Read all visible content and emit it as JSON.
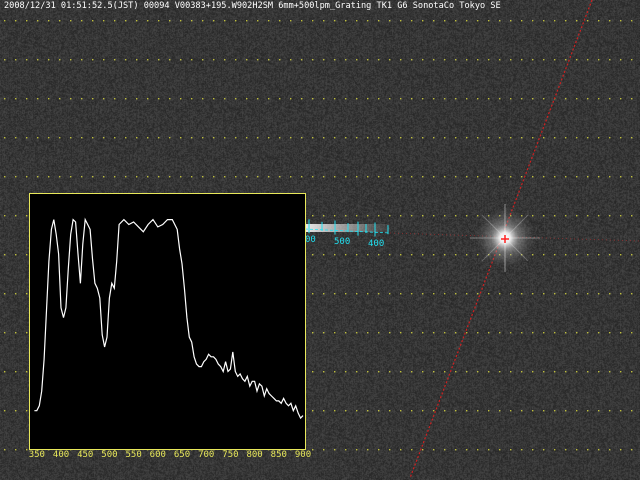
{
  "header": {
    "caption": "2008/12/31 01:51:52.5(JST) 00094 V00383+195.W902H2SM 6mm+500lpm_Grating TK1 G6 SonotaCo Tokyo SE"
  },
  "calibration_scale": {
    "labels": [
      "00",
      "500",
      "400"
    ]
  },
  "colors": {
    "panel_border": "#e8e85a",
    "spectrum_line": "#ffffff",
    "grid_dots": "#d8d840",
    "scale_marks": "#22e0f0",
    "meteor_track": "#d02020",
    "marker": "#ff2020"
  },
  "icons": {
    "zero_order_marker": "red-cross-marker"
  },
  "chart_data": {
    "type": "line",
    "title": "",
    "xlabel": "",
    "ylabel": "",
    "xlim": [
      340,
      900
    ],
    "ylim": [
      0,
      100
    ],
    "tick_labels": [
      "350",
      "400",
      "450",
      "500",
      "550",
      "600",
      "650",
      "700",
      "750",
      "800",
      "850",
      "900"
    ],
    "series": [
      {
        "x": [
          345,
          350,
          355,
          360,
          365,
          370,
          375,
          380,
          385,
          390,
          395,
          400,
          405,
          410,
          415,
          420,
          425,
          430,
          435,
          440,
          445,
          450,
          455,
          460,
          465,
          470,
          475,
          480,
          485,
          490,
          495,
          500,
          505,
          510,
          515,
          520,
          530,
          540,
          550,
          560,
          570,
          580,
          590,
          600,
          610,
          620,
          630,
          640,
          645,
          650,
          655,
          660,
          665,
          670,
          675,
          680,
          685,
          690,
          695,
          700,
          705,
          710,
          715,
          720,
          725,
          730,
          735,
          740,
          745,
          750,
          755,
          760,
          765,
          770,
          775,
          780,
          785,
          790,
          795,
          800,
          805,
          810,
          815,
          820,
          825,
          830,
          835,
          840,
          845,
          850,
          855,
          860,
          865,
          870,
          875,
          880,
          885,
          890,
          895,
          900
        ],
        "y": [
          14,
          14,
          16,
          22,
          35,
          55,
          75,
          88,
          92,
          86,
          78,
          56,
          52,
          56,
          72,
          86,
          92,
          91,
          78,
          66,
          82,
          92,
          90,
          88,
          76,
          66,
          64,
          60,
          45,
          40,
          44,
          60,
          66,
          64,
          75,
          90,
          92,
          90,
          91,
          89,
          87,
          90,
          92,
          89,
          90,
          92,
          92,
          88,
          80,
          74,
          64,
          52,
          44,
          42,
          36,
          33,
          32,
          32,
          34,
          35,
          37,
          36,
          36,
          35,
          33,
          32,
          30,
          34,
          30,
          31,
          38,
          30,
          28,
          29,
          27,
          26,
          28,
          24,
          26,
          26,
          22,
          25,
          24,
          20,
          23,
          21,
          20,
          19,
          18,
          18,
          17,
          19,
          17,
          16,
          17,
          14,
          16,
          13,
          11,
          12
        ]
      }
    ]
  }
}
